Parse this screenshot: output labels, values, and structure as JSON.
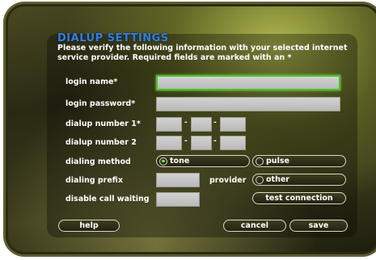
{
  "dialog": {
    "title": "DIALUP SETTINGS",
    "intro": "Please verify the following information with your selected internet service provider.  Required fields are marked with an *"
  },
  "fields": {
    "login_name_label": "login name*",
    "login_name_value": "",
    "login_password_label": "login password*",
    "login_password_value": "",
    "dialup1_label": "dialup number 1*",
    "dialup1_value": [
      "",
      "",
      ""
    ],
    "dialup2_label": "dialup number 2",
    "dialup2_value": [
      "",
      "",
      ""
    ],
    "dial_separator": "-",
    "dialing_method_label": "dialing method",
    "dialing_method_options": [
      "tone",
      "pulse"
    ],
    "dialing_method_selected": "tone",
    "dialing_prefix_label": "dialing prefix",
    "dialing_prefix_value": "",
    "provider_label": "provider",
    "provider_option": "other",
    "disable_call_waiting_label": "disable call waiting",
    "disable_call_waiting_value": ""
  },
  "buttons": {
    "test_connection": "test connection",
    "help": "help",
    "cancel": "cancel",
    "save": "save"
  },
  "colors": {
    "title": "#2f7fe0",
    "focus": "#4ec02a",
    "field": "#c6c6c6"
  }
}
